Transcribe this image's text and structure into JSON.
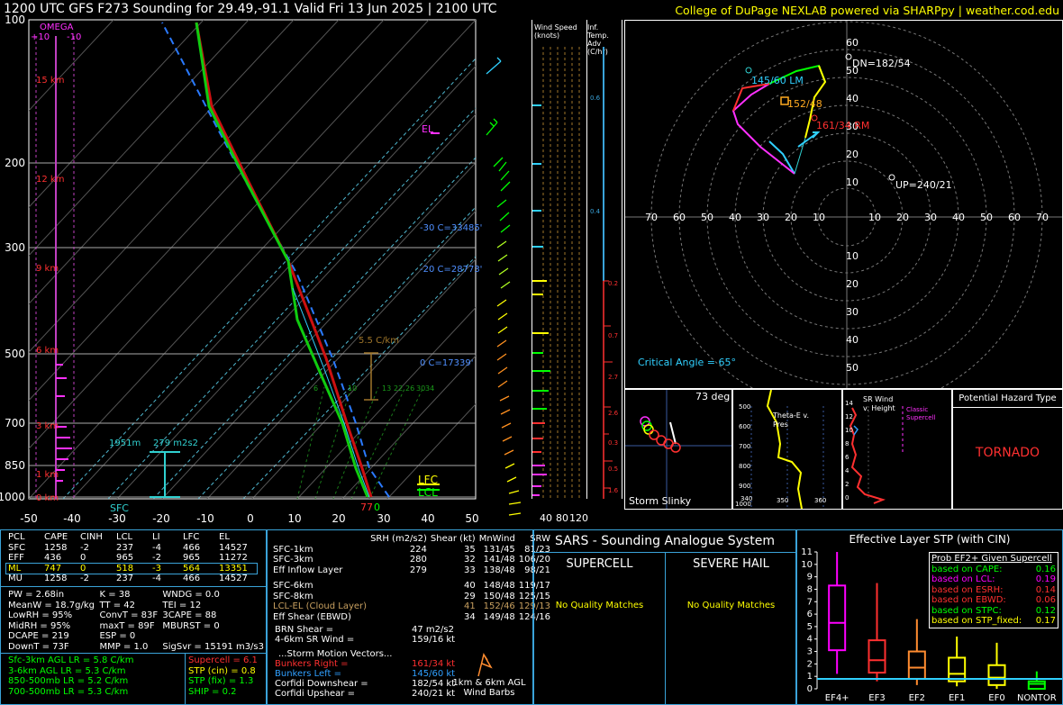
{
  "header": {
    "title": "1200 UTC GFS F273 Sounding for 29.49,-91.1 Valid  Fri 13 Jun 2025 | 2100 UTC",
    "credit": "College of DuPage NEXLAB powered via SHARPpy | weather.cod.edu"
  },
  "skewt": {
    "pressure_ticks": [
      "100",
      "200",
      "300",
      "500",
      "700",
      "850",
      "1000"
    ],
    "temp_ticks": [
      "-50",
      "-40",
      "-30",
      "-20",
      "-10",
      "0",
      "10",
      "20",
      "30",
      "40",
      "50"
    ],
    "height_labels": [
      "15 km",
      "12 km",
      "9 km",
      "6 km",
      "3 km",
      "1 km",
      "0 km"
    ],
    "omega_label": "OMEGA",
    "omega_ticks": [
      "+10",
      "-10"
    ],
    "el_label": "EL",
    "lfc_label": "LFC",
    "lcl_label": "LCL",
    "sfc_label": "SFC",
    "sfc_temp": "77",
    "sfc_td": "0",
    "iso_labels": [
      "-30 C=33485'",
      "-20 C=28773'",
      "0 C=17339'"
    ],
    "lapse_label": "5.5 C/km",
    "effective_layer": {
      "depth": "1951m",
      "srh": "279 m2s2"
    },
    "wetbulb_labels": [
      "6",
      "10",
      "13",
      "22",
      "26",
      "30",
      "34"
    ]
  },
  "wind_speed_panel": {
    "title": "Wind Speed (knots)",
    "ticks": [
      "40",
      "80",
      "120"
    ]
  },
  "temp_adv_panel": {
    "title": "Inf. Temp. Adv (C/hr)",
    "labels": [
      "0.6",
      "0.4",
      "0.2",
      "0.7",
      "2.7",
      "2.6",
      "0.3",
      "0.5",
      "1.6"
    ]
  },
  "hodograph": {
    "rings": [
      "70",
      "60",
      "50",
      "40",
      "30",
      "20",
      "10"
    ],
    "ring_labels_up": [
      "60",
      "50",
      "40",
      "30",
      "20",
      "10"
    ],
    "ring_labels_down": [
      "10",
      "20",
      "30",
      "40",
      "50",
      "60"
    ],
    "labels": {
      "dn": "DN=182/54",
      "lm": "145/60 LM",
      "mean": "152/48",
      "rm": "161/34 RM",
      "up": "UP=240/21"
    },
    "critical_angle": "Critical Angle = 65°"
  },
  "slinky": {
    "deg": "73 deg",
    "title": "Storm Slinky"
  },
  "theta_panel": {
    "title": "Theta-E v. Pres",
    "p_ticks": [
      "500",
      "600",
      "700",
      "800",
      "900",
      "1000"
    ],
    "x_ticks": [
      "340",
      "350",
      "360"
    ]
  },
  "srwind_panel": {
    "title": "SR Wind v. Height",
    "tag": "Classic Supercell",
    "h_ticks": [
      "14",
      "12",
      "10",
      "8",
      "6",
      "4",
      "2",
      "0"
    ]
  },
  "hazard": {
    "title": "Potential Hazard Type",
    "value": "TORNADO"
  },
  "parcels": {
    "headers": [
      "PCL",
      "CAPE",
      "CINH",
      "LCL",
      "LI",
      "LFC",
      "EL"
    ],
    "rows": [
      [
        "SFC",
        "1258",
        "-2",
        "237",
        "-4",
        "466",
        "14527"
      ],
      [
        "EFF",
        "436",
        "0",
        "965",
        "-2",
        "965",
        "11272"
      ],
      [
        "ML",
        "747",
        "0",
        "518",
        "-3",
        "564",
        "13351"
      ],
      [
        "MU",
        "1258",
        "-2",
        "237",
        "-4",
        "466",
        "14527"
      ]
    ]
  },
  "indices": [
    [
      "PW = 2.68in",
      "K = 38",
      "WNDG = 0.0"
    ],
    [
      "MeanW = 18.7g/kg",
      "TT = 42",
      "TEI = 12"
    ],
    [
      "LowRH = 95%",
      "ConvT = 83F",
      "3CAPE = 88"
    ],
    [
      "MidRH = 95%",
      "maxT = 89F",
      "MBURST = 0"
    ],
    [
      "DCAPE = 219",
      "ESP = 0",
      ""
    ],
    [
      "DownT = 73F",
      "MMP = 1.0",
      "SigSvr = 15191 m3/s3"
    ]
  ],
  "lapse_rates": [
    "Sfc-3km AGL LR = 5.8 C/km",
    "3-6km AGL LR = 5.3 C/km",
    "850-500mb LR = 5.2 C/km",
    "700-500mb LR = 5.3 C/km"
  ],
  "composites": [
    "Supercell = 6.1",
    "STP (cin) = 0.8",
    "STP (fix) = 1.3",
    "SHIP = 0.2"
  ],
  "kinematics": {
    "headers": [
      "",
      "SRH (m2/s2)",
      "Shear (kt)",
      "MnWind",
      "SRW"
    ],
    "rows": [
      [
        "SFC-1km",
        "224",
        "35",
        "131/45",
        "81/23"
      ],
      [
        "SFC-3km",
        "280",
        "32",
        "141/48",
        "106/20"
      ],
      [
        "Eff Inflow Layer",
        "279",
        "33",
        "138/48",
        "98/21"
      ],
      [
        "SFC-6km",
        "40",
        "148/48",
        "119/17",
        ""
      ],
      [
        "SFC-8km",
        "29",
        "150/48",
        "125/15",
        ""
      ],
      [
        "LCL-EL (Cloud Layer)",
        "41",
        "152/46",
        "129/13",
        ""
      ],
      [
        "Eff Shear (EBWD)",
        "34",
        "149/48",
        "124/16",
        ""
      ]
    ],
    "brn": [
      "BRN Shear =",
      "47 m2/s2"
    ],
    "sr46": [
      "4-6km SR Wind =",
      "159/16 kt"
    ],
    "storm_motion_title": "...Storm Motion Vectors...",
    "motions": [
      [
        "Bunkers Right =",
        "161/34 kt"
      ],
      [
        "Bunkers Left =",
        "145/60 kt"
      ],
      [
        "Corfidi Downshear =",
        "182/54 kt"
      ],
      [
        "Corfidi Upshear =",
        "240/21 kt"
      ]
    ],
    "barb_label": "1km & 6km AGL Wind Barbs"
  },
  "sars": {
    "title": "SARS - Sounding Analogue System",
    "supercell": "SUPERCELL",
    "hail": "SEVERE HAIL",
    "no_match_1": "No Quality Matches",
    "no_match_2": "No Quality Matches"
  },
  "chart_data": {
    "type": "box",
    "title": "Effective Layer STP (with CIN)",
    "categories": [
      "EF4+",
      "EF3",
      "EF2",
      "EF1",
      "EF0",
      "NONTOR"
    ],
    "yticks": [
      "0",
      "1",
      "2",
      "3",
      "4",
      "5",
      "6",
      "7",
      "8",
      "9",
      "10",
      "11"
    ],
    "ylim": [
      0,
      11
    ],
    "boxes": [
      {
        "name": "EF4+",
        "whisker_low": 1.2,
        "q1": 3.1,
        "median": 5.3,
        "q3": 8.3,
        "whisker_high": 11.0,
        "color": "#ff00ff"
      },
      {
        "name": "EF3",
        "whisker_low": 0.6,
        "q1": 1.3,
        "median": 2.3,
        "q3": 3.9,
        "whisker_high": 8.5,
        "color": "#ff3030"
      },
      {
        "name": "EF2",
        "whisker_low": 0.3,
        "q1": 0.8,
        "median": 1.7,
        "q3": 3.0,
        "whisker_high": 5.6,
        "color": "#ff8c30"
      },
      {
        "name": "EF1",
        "whisker_low": 0.2,
        "q1": 0.6,
        "median": 1.2,
        "q3": 2.5,
        "whisker_high": 4.2,
        "color": "#ffff00"
      },
      {
        "name": "EF0",
        "whisker_low": 0.0,
        "q1": 0.3,
        "median": 0.9,
        "q3": 1.9,
        "whisker_high": 3.7,
        "color": "#ffff00"
      },
      {
        "name": "NONTOR",
        "whisker_low": 0.0,
        "q1": 0.0,
        "median": 0.4,
        "q3": 0.6,
        "whisker_high": 1.4,
        "color": "#00ff00"
      }
    ],
    "current_value": 0.8,
    "legend": {
      "title": "Prob EF2+ Given Supercell",
      "items": [
        [
          "based on CAPE:",
          "0.16",
          "#00ff00"
        ],
        [
          "based on LCL:",
          "0.19",
          "#ff00ff"
        ],
        [
          "based on ESRH:",
          "0.14",
          "#ff3030"
        ],
        [
          "based on EBWD:",
          "0.06",
          "#ff3030"
        ],
        [
          "based on STPC:",
          "0.12",
          "#00ff00"
        ],
        [
          "based on STP_fixed:",
          "0.17",
          "#ffff00"
        ]
      ]
    }
  }
}
